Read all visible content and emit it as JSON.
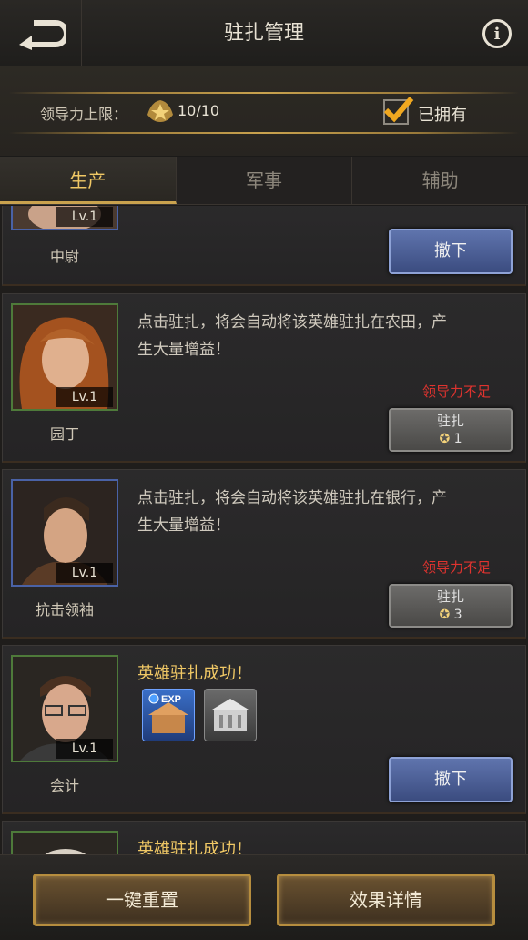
{
  "header": {
    "title": "驻扎管理",
    "back_icon": "back-arrow-icon",
    "info_icon": "info-icon"
  },
  "leadership": {
    "label": "领导力上限：",
    "value": "10/10",
    "owned_label": "已拥有",
    "owned_checked": true
  },
  "tabs": [
    {
      "label": "生产",
      "active": true
    },
    {
      "label": "军事",
      "active": false
    },
    {
      "label": "辅助",
      "active": false
    }
  ],
  "cards": [
    {
      "name": "中尉",
      "level": "Lv.1",
      "button": "撤下"
    },
    {
      "name": "园丁",
      "level": "Lv.1",
      "desc": "点击驻扎，将会自动将该英雄驻扎在农田，产生大量增益！",
      "warning": "领导力不足",
      "button": "驻扎",
      "cost": "1"
    },
    {
      "name": "抗击领袖",
      "level": "Lv.1",
      "desc": "点击驻扎，将会自动将该英雄驻扎在银行，产生大量增益！",
      "warning": "领导力不足",
      "button": "驻扎",
      "cost": "3"
    },
    {
      "name": "会计",
      "level": "Lv.1",
      "status": "英雄驻扎成功！",
      "button": "撤下",
      "bonus_icons": [
        "exp-building-icon",
        "bank-icon"
      ]
    },
    {
      "status": "英雄驻扎成功！"
    }
  ],
  "footer": {
    "reset": "一键重置",
    "details": "效果详情"
  },
  "colors": {
    "accent": "#f0c865",
    "warning": "#e0332f",
    "blue_button": "#4a5e99"
  }
}
